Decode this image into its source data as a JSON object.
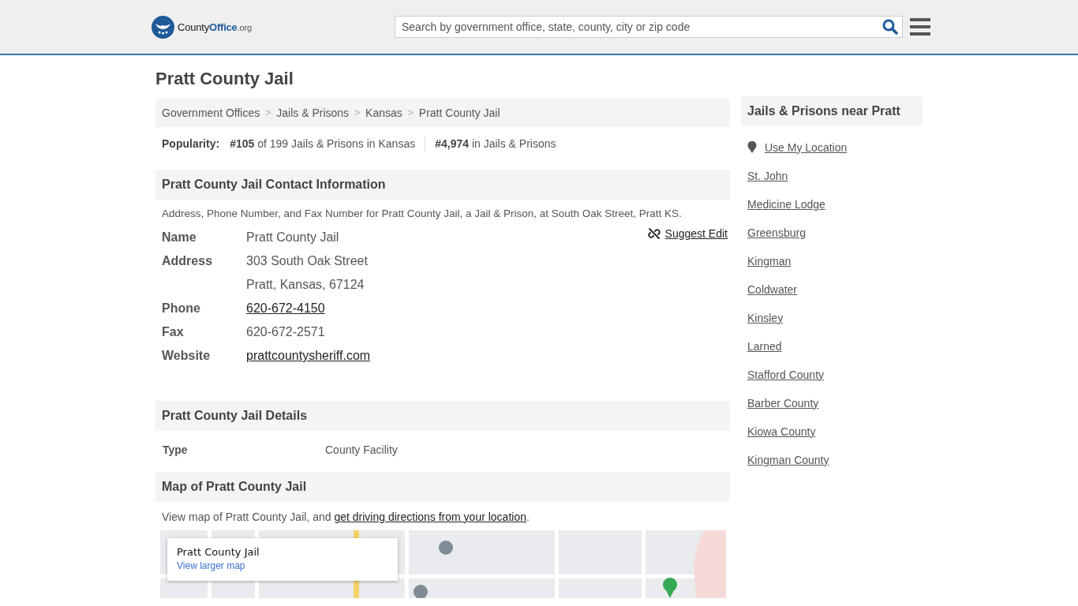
{
  "header": {
    "logo": {
      "parts": [
        "County",
        "Office",
        ".org"
      ]
    },
    "search": {
      "placeholder": "Search by government office, state, county, city or zip code"
    }
  },
  "title": "Pratt County Jail",
  "breadcrumbs": [
    {
      "label": "Government Offices",
      "separator": ">"
    },
    {
      "label": "Jails & Prisons",
      "separator": ">"
    },
    {
      "label": "Kansas",
      "separator": ">"
    },
    {
      "label": "Pratt County Jail"
    }
  ],
  "popularity": {
    "label": "Popularity:",
    "ranks": [
      "**#105** of 199 Jails & Prisons in Kansas",
      "**#4,974** in Jails & Prisons"
    ]
  },
  "contact": {
    "heading": "Pratt County Jail Contact Information",
    "description": "Address, Phone Number, and Fax Number for Pratt County Jail, a Jail & Prison, at South Oak Street, Pratt KS.",
    "suggest_edit": "Suggest Edit",
    "rows": [
      {
        "label": "Name",
        "value": "Pratt County Jail",
        "kind": "text"
      },
      {
        "label": "Address",
        "value": "303 South Oak Street",
        "kind": "text"
      },
      {
        "value": "Pratt, Kansas, 67124",
        "kind": "text"
      },
      {
        "label": "Phone",
        "value": "620-672-4150",
        "kind": "link"
      },
      {
        "label": "Fax",
        "value": "620-672-2571",
        "kind": "text"
      },
      {
        "label": "Website",
        "value": "prattcountysheriff.com",
        "kind": "link"
      }
    ]
  },
  "details": {
    "heading": "Pratt County Jail Details",
    "rows": [
      {
        "label": "Type",
        "value": "County Facility"
      }
    ]
  },
  "map": {
    "heading": "Map of Pratt County Jail",
    "description": "View map of Pratt County Jail, and ",
    "link": "get driving directions from your location",
    "after": ".",
    "card": {
      "title": "Pratt County Jail",
      "link": "View larger map"
    }
  },
  "sidebar": {
    "heading": "Jails & Prisons near Pratt",
    "use_location": "Use My Location",
    "links": [
      "St. John",
      "Medicine Lodge",
      "Greensburg",
      "Kingman",
      "Coldwater",
      "Kinsley",
      "Larned",
      "Stafford County",
      "Barber County",
      "Kiowa County",
      "Kingman County"
    ]
  }
}
